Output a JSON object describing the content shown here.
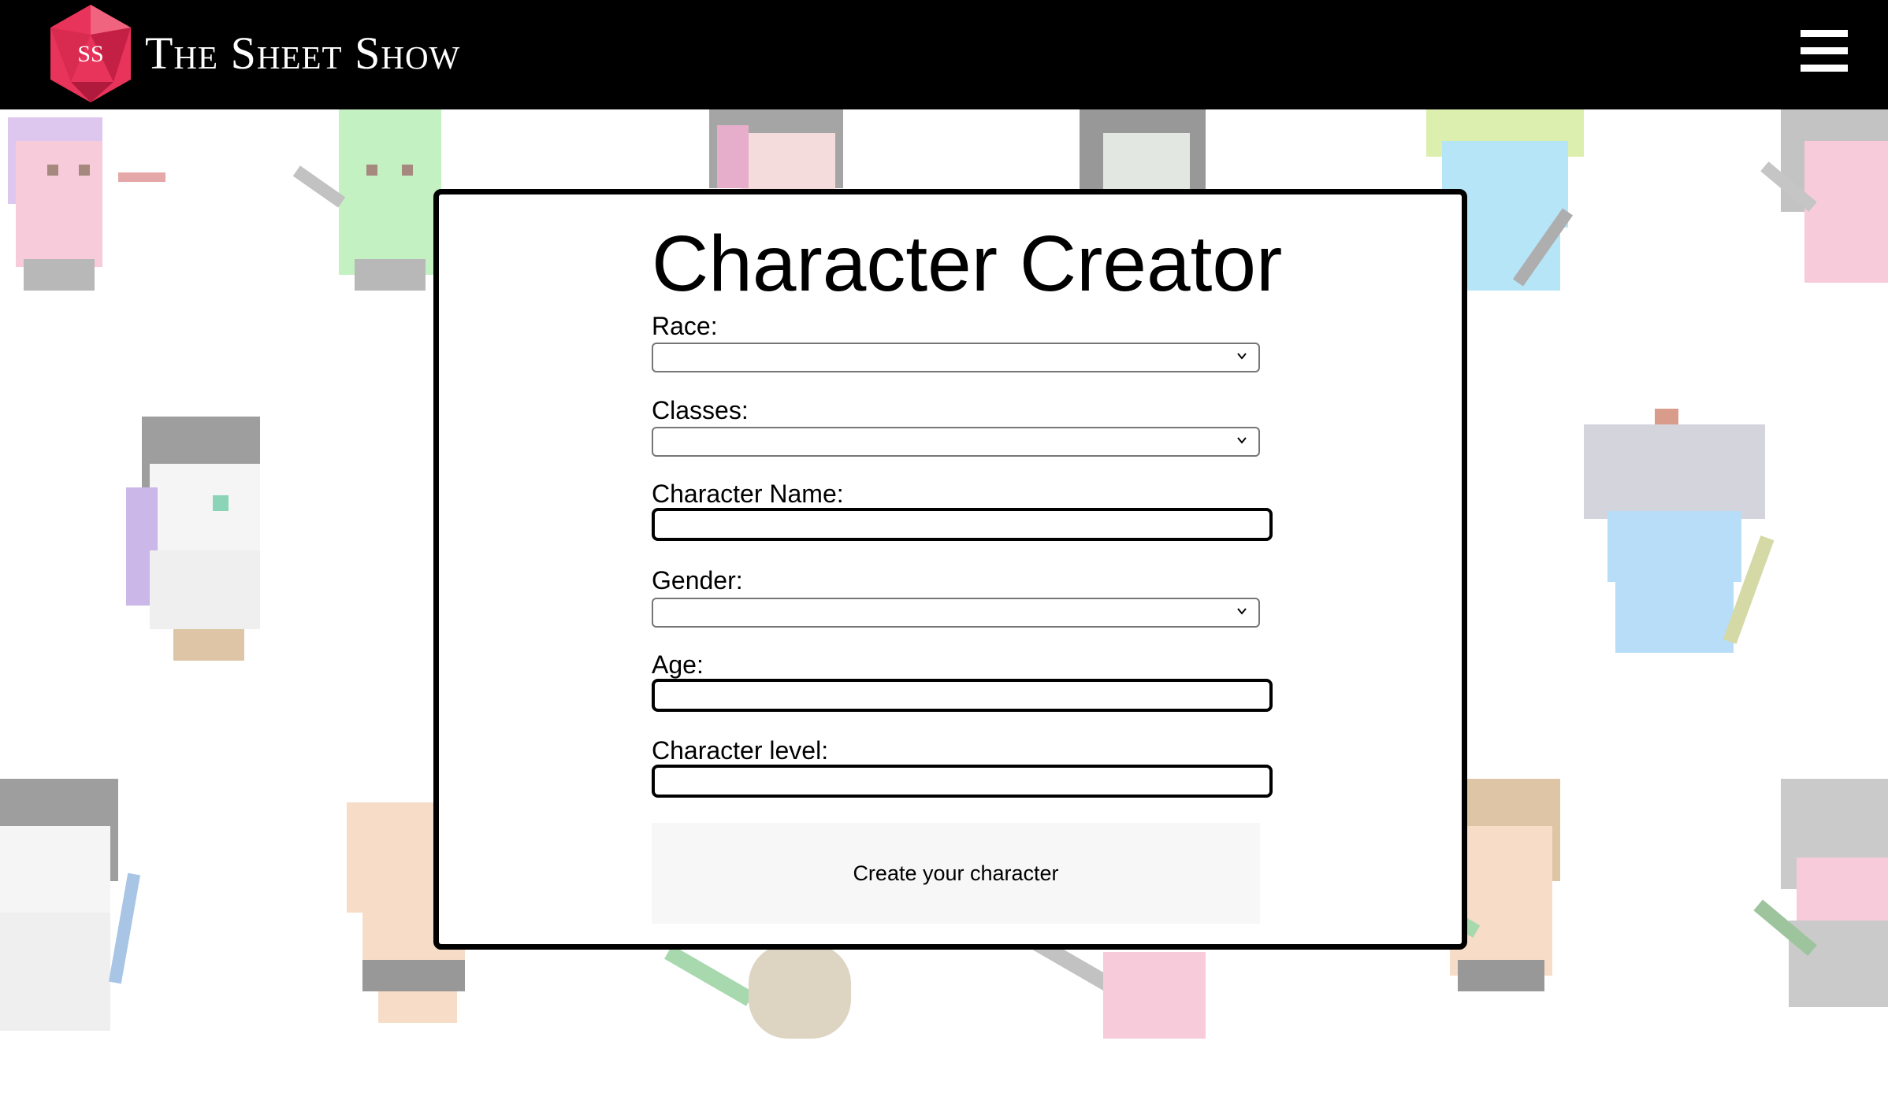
{
  "header": {
    "logo_initials": "SS",
    "site_title": "The Sheet Show",
    "brand_color": "#e8335a",
    "menu_icon": "hamburger-menu-icon"
  },
  "form": {
    "title": "Character Creator",
    "fields": {
      "race": {
        "label": "Race:",
        "value": ""
      },
      "classes": {
        "label": "Classes:",
        "value": ""
      },
      "character_name": {
        "label": "Character Name:",
        "value": ""
      },
      "gender": {
        "label": "Gender:",
        "value": ""
      },
      "age": {
        "label": "Age:",
        "value": ""
      },
      "character_level": {
        "label": "Character level:",
        "value": ""
      }
    },
    "submit_label": "Create your character"
  },
  "background": {
    "sprites": [
      "elf-archer",
      "orc-warrior",
      "skeleton-mage",
      "knight",
      "dwarf",
      "human-fighter"
    ]
  }
}
